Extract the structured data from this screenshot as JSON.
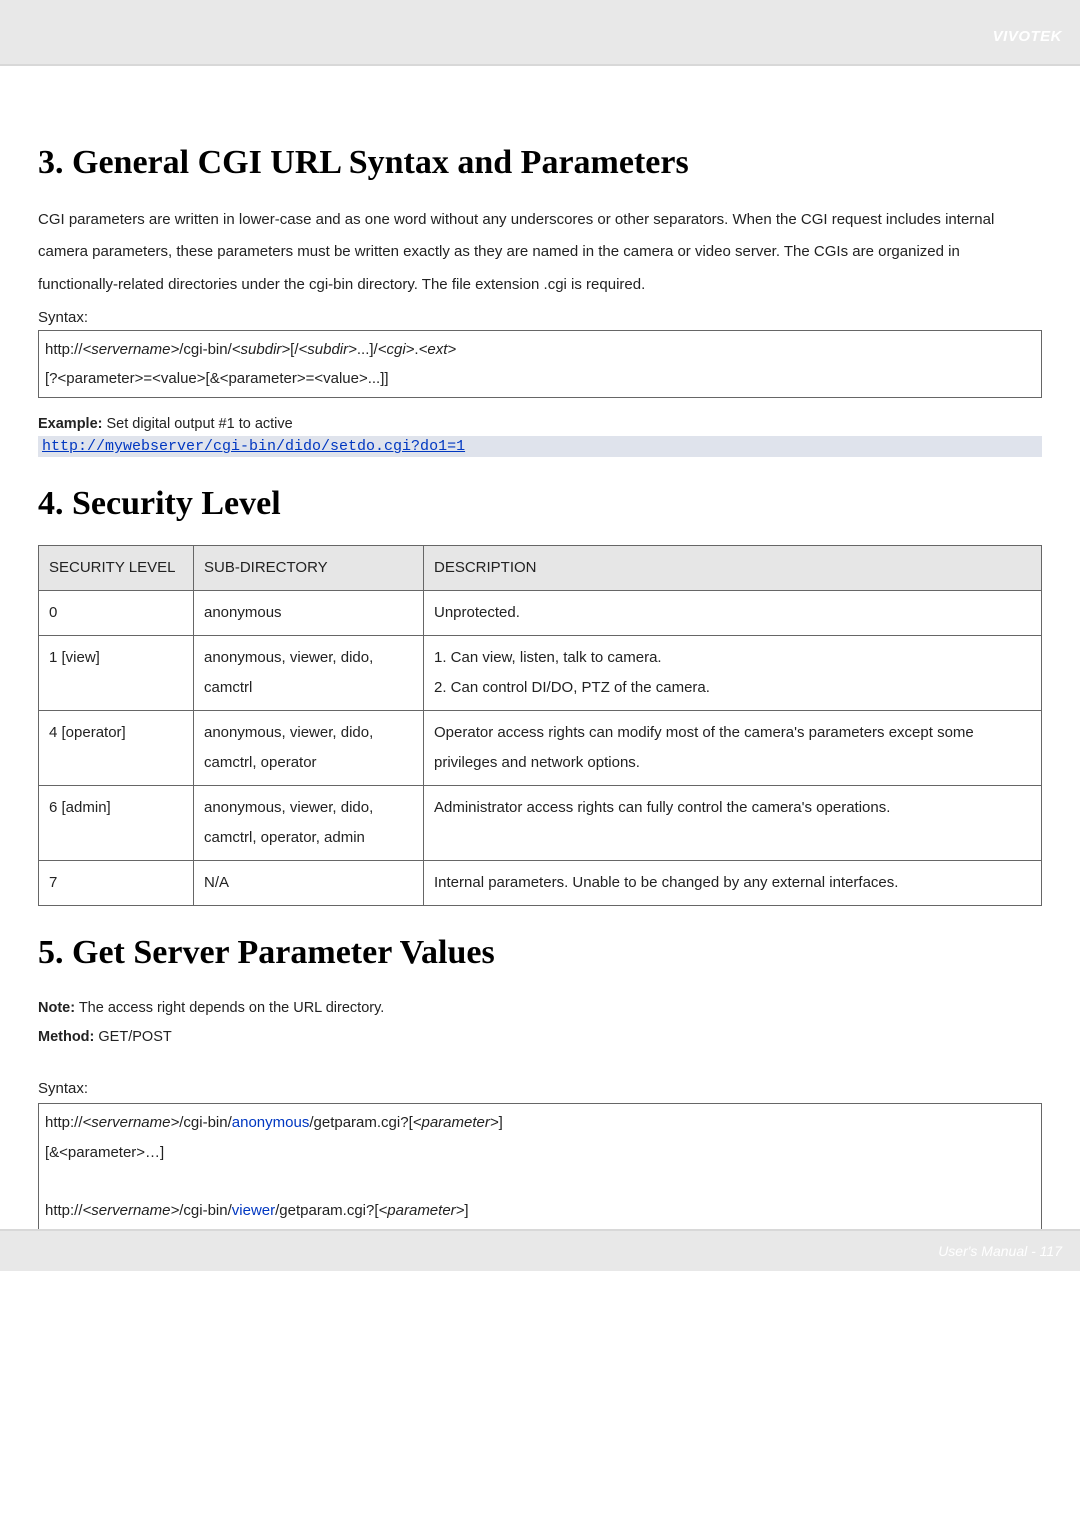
{
  "brand": "VIVOTEK",
  "footer": "User's Manual - 117",
  "section3": {
    "title": "3. General CGI URL Syntax and Parameters",
    "para": "CGI parameters are written in lower-case and as one word without any underscores or other separators. When the CGI request includes internal camera parameters, these parameters must be written exactly as they are named in the camera or video server. The CGIs are organized in functionally-related directories under the cgi-bin directory. The file extension .cgi is required.",
    "syntax_label": "Syntax:",
    "syntax_l1_a": "http://",
    "syntax_l1_b": "<servername>",
    "syntax_l1_c": "/cgi-bin/",
    "syntax_l1_d": "<subdir>",
    "syntax_l1_e": "[/",
    "syntax_l1_f": "<subdir>",
    "syntax_l1_g": "...]/",
    "syntax_l1_h": "<cgi>",
    "syntax_l1_i": ".",
    "syntax_l1_j": "<ext>",
    "syntax_l2": "[?<parameter>=<value>[&<parameter>=<value>...]]",
    "example_label": "Example:",
    "example_text": " Set digital output #1 to active",
    "example_url": "http://mywebserver/cgi-bin/dido/setdo.cgi?do1=1"
  },
  "section4": {
    "title": "4. Security Level",
    "headers": [
      "SECURITY LEVEL",
      "SUB-DIRECTORY",
      "DESCRIPTION"
    ],
    "rows": [
      {
        "a": "0",
        "b": "anonymous",
        "c": "Unprotected."
      },
      {
        "a": "1 [view]",
        "b": "anonymous, viewer, dido, camctrl",
        "c": "1. Can view, listen, talk to camera.\n2. Can control DI/DO, PTZ of the camera."
      },
      {
        "a": "4 [operator]",
        "b": "anonymous, viewer, dido, camctrl, operator",
        "c": "Operator access rights can modify most of the camera's parameters except some privileges and network options."
      },
      {
        "a": "6 [admin]",
        "b": "anonymous, viewer, dido, camctrl, operator, admin",
        "c": "Administrator access rights can fully control the camera's operations."
      },
      {
        "a": "7",
        "b": "N/A",
        "c": "Internal parameters. Unable to be changed by any external interfaces."
      }
    ]
  },
  "section5": {
    "title": "5. Get Server Parameter Values",
    "note_label": "Note:",
    "note_text": " The access right depends on the URL directory.",
    "method_label": "Method:",
    "method_text": " GET/POST",
    "syntax_label": "Syntax:",
    "l1_a": "http://",
    "l1_b": "<servername>",
    "l1_c": "/cgi-bin/",
    "l1_d": "anonymous",
    "l1_e": "/getparam.cgi?[",
    "l1_f": "<parameter>",
    "l1_g": "]",
    "l2": "[&<parameter>…]",
    "l3_a": "http://",
    "l3_b": "<servername>",
    "l3_c": "/cgi-bin/",
    "l3_d": "viewer",
    "l3_e": "/getparam.cgi?[",
    "l3_f": "<parameter>",
    "l3_g": "]"
  }
}
